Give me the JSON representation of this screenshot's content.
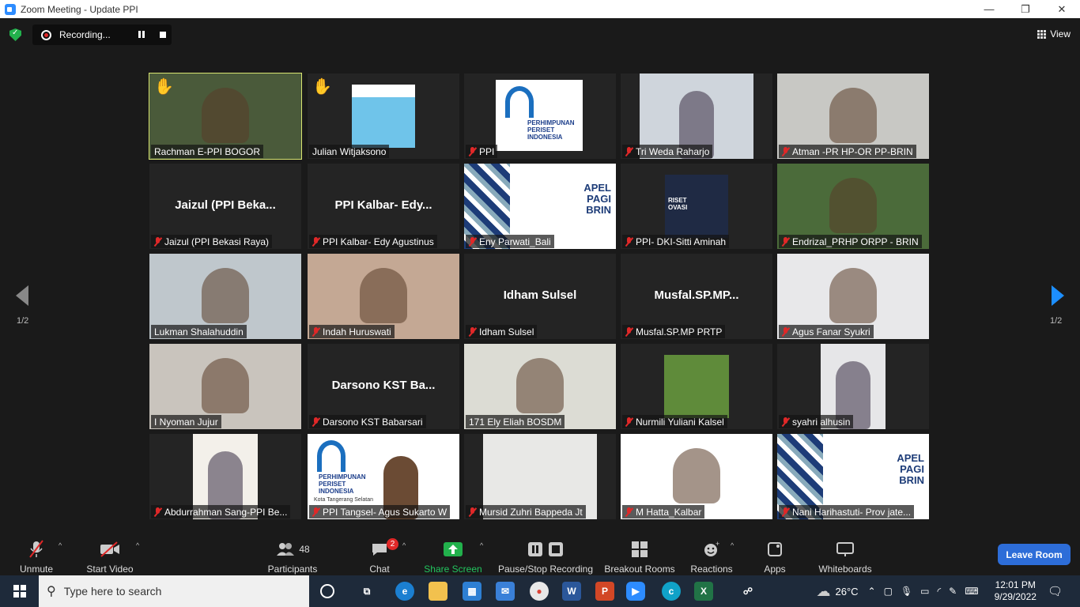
{
  "window": {
    "title": "Zoom Meeting - Update PPI",
    "minimize": "—",
    "maximize": "❐",
    "close": "✕"
  },
  "recording": {
    "label": "Recording..."
  },
  "view": {
    "label": "View"
  },
  "pagination": {
    "left": "1/2",
    "right": "1/2"
  },
  "tiles": [
    {
      "name": "Rachman E-PPI BOGOR",
      "muted": false,
      "hand": true,
      "active": true,
      "bg": "#4a5a3a",
      "video": "full"
    },
    {
      "name": "Julian Witjaksono",
      "muted": false,
      "hand": true,
      "bg": "#242424",
      "video": "slide-blue"
    },
    {
      "name": "PPI",
      "muted": true,
      "bg": "#242424",
      "video": "ppi-logo"
    },
    {
      "name": "Tri Weda Raharjo",
      "muted": true,
      "bg": "#242424",
      "video": "center-person"
    },
    {
      "name": "Atman -PR HP-OR PP-BRIN",
      "muted": true,
      "bg": "#c8c8c4",
      "video": "full"
    },
    {
      "name": "Jaizul (PPI Bekasi Raya)",
      "big": "Jaizul  (PPI  Beka...",
      "muted": true,
      "bg": "#242424",
      "video": "none"
    },
    {
      "name": "PPI Kalbar- Edy Agustinus",
      "big": "PPI  Kalbar-  Edy...",
      "muted": true,
      "bg": "#242424",
      "video": "none"
    },
    {
      "name": "Eny Parwati_Bali",
      "muted": true,
      "bg": "#ffffff",
      "video": "apel",
      "apel": "APEL PAGI BRIN"
    },
    {
      "name": "PPI- DKI-Sitti Aminah",
      "muted": true,
      "bg": "#242424",
      "video": "riset",
      "riset": "RISET OVASI"
    },
    {
      "name": "Endrizal_PRHP ORPP - BRIN",
      "muted": true,
      "bg": "#4b6b3a",
      "video": "full"
    },
    {
      "name": "Lukman Shalahuddin",
      "muted": false,
      "bg": "#bfc7cc",
      "video": "full"
    },
    {
      "name": "Indah Huruswati",
      "muted": true,
      "bg": "#c4a894",
      "video": "full"
    },
    {
      "name": "Idham Sulsel",
      "big": "Idham Sulsel",
      "muted": true,
      "bg": "#242424",
      "video": "none"
    },
    {
      "name": "Musfal.SP.MP   PRTP",
      "big": "Musfal.SP.MP...",
      "muted": true,
      "bg": "#242424",
      "video": "none"
    },
    {
      "name": "Agus Fanar Syukri",
      "muted": true,
      "bg": "#e8e8ea",
      "video": "full"
    },
    {
      "name": "I Nyoman Jujur",
      "muted": false,
      "bg": "#c9c4bd",
      "video": "full"
    },
    {
      "name": "Darsono KST Babarsari",
      "big": "Darsono  KST  Ba...",
      "muted": true,
      "bg": "#242424",
      "video": "none"
    },
    {
      "name": "171 Ely Eliah BOSDM",
      "muted": false,
      "bg": "#dcdcd4",
      "video": "full"
    },
    {
      "name": "Nurmili Yuliani Kalsel",
      "muted": true,
      "bg": "#242424",
      "video": "center-field"
    },
    {
      "name": "syahri alhusin",
      "muted": true,
      "bg": "#242424",
      "video": "center-person2"
    },
    {
      "name": "Abdurrahman Sang-PPI Be...",
      "muted": true,
      "bg": "#242424",
      "video": "center-person3"
    },
    {
      "name": "PPI Tangsel- Agus Sukarto W",
      "muted": true,
      "bg": "#ffffff",
      "video": "ppi-tangsel",
      "sub": "Kota Tangerang Selatan"
    },
    {
      "name": "Mursid Zuhri Bappeda Jt",
      "muted": true,
      "bg": "#242424",
      "video": "center-ceiling"
    },
    {
      "name": "M Hatta_Kalbar",
      "muted": true,
      "bg": "#ffffff",
      "video": "full"
    },
    {
      "name": "Nani Harihastuti- Prov jate...",
      "muted": true,
      "bg": "#ffffff",
      "video": "apel",
      "apel": "APEL PAGI BRIN"
    }
  ],
  "logo_text": "PERHIMPUNAN PERISET INDONESIA",
  "toolbar": {
    "unmute": "Unmute",
    "start_video": "Start Video",
    "participants": "Participants",
    "participants_count": "48",
    "chat": "Chat",
    "chat_badge": "2",
    "share": "Share Screen",
    "recording": "Pause/Stop Recording",
    "breakout": "Breakout Rooms",
    "reactions": "Reactions",
    "apps": "Apps",
    "whiteboards": "Whiteboards",
    "leave": "Leave Room"
  },
  "taskbar": {
    "search_placeholder": "Type here to search",
    "weather": "26°C",
    "time": "12:01 PM",
    "date": "9/29/2022"
  }
}
